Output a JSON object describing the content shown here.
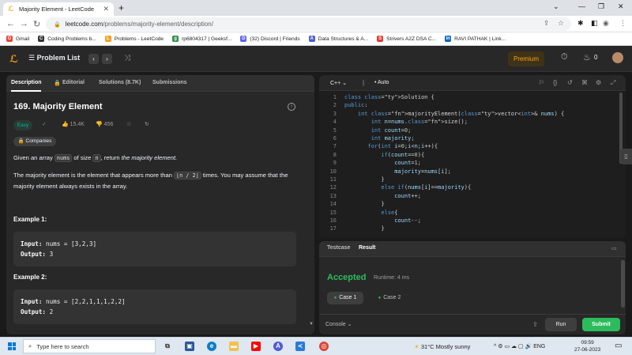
{
  "browser": {
    "tab_title": "Majority Element - LeetCode",
    "url_host": "leetcode.com",
    "url_path": "/problems/majority-element/description/",
    "bookmarks": [
      {
        "label": "Gmail",
        "color": "#ea4335",
        "glyph": "G"
      },
      {
        "label": "Coding Problems b...",
        "color": "#333333",
        "glyph": "C"
      },
      {
        "label": "Problems - LeetCode",
        "color": "#f89f1b",
        "glyph": "L"
      },
      {
        "label": "rp6804317 | Geeksf...",
        "color": "#2f8d46",
        "glyph": "g"
      },
      {
        "label": "(32) Discord | Friends",
        "color": "#5865f2",
        "glyph": "D"
      },
      {
        "label": "Data Structures & A...",
        "color": "#4f5bd5",
        "glyph": "A"
      },
      {
        "label": "Strivers A2Z DSA C...",
        "color": "#e03c31",
        "glyph": "S"
      },
      {
        "label": "RAVI PATHAK | Link...",
        "color": "#0a66c2",
        "glyph": "in"
      }
    ]
  },
  "header": {
    "problem_list": "Problem List",
    "premium": "Premium",
    "streak": "0"
  },
  "left": {
    "tabs": [
      "Description",
      "Editorial",
      "Solutions (8.7K)",
      "Submissions"
    ],
    "title": "169. Majority Element",
    "difficulty": "Easy",
    "likes": "15.4K",
    "dislikes": "456",
    "companies": "Companies",
    "desc1_pre": "Given an array ",
    "desc1_code1": "nums",
    "desc1_mid": " of size ",
    "desc1_code2": "n",
    "desc1_post": ", return ",
    "desc1_em": "the majority element.",
    "desc2_pre": "The majority element is the element that appears more than ",
    "desc2_code": "⌊n / 2⌋",
    "desc2_post": " times. You may assume that the majority element always exists in the array.",
    "examples": [
      {
        "heading": "Example 1:",
        "input_label": "Input:",
        "input": " nums = [3,2,3]",
        "output_label": "Output:",
        "output": " 3"
      },
      {
        "heading": "Example 2:",
        "input_label": "Input:",
        "input": " nums = [2,2,1,1,1,2,2]",
        "output_label": "Output:",
        "output": " 2"
      }
    ]
  },
  "editor": {
    "language": "C++",
    "mode": "Auto",
    "line_numbers": [
      "1",
      "2",
      "3",
      "4",
      "5",
      "6",
      "7",
      "8",
      "9",
      "10",
      "11",
      "12",
      "13",
      "14",
      "15",
      "16",
      "17"
    ]
  },
  "code_lines": [
    "class Solution {",
    "public:",
    "    int majorityElement(vector<int>& nums) {",
    "        int n=nums.size();",
    "        int count=0;",
    "        int majority;",
    "       for(int i=0;i<n;i++){",
    "           if(count==0){",
    "               count=1;",
    "               majority=nums[i];",
    "           }",
    "           else if(nums[i]==majority){",
    "               count++;",
    "           }",
    "           else{",
    "               count--;",
    "           }"
  ],
  "result": {
    "tabs": [
      "Testcase",
      "Result"
    ],
    "status": "Accepted",
    "runtime": "Runtime: 4 ms",
    "case1": "Case 1",
    "case2": "Case 2",
    "console": "Console",
    "run": "Run",
    "submit": "Submit"
  },
  "taskbar": {
    "search_placeholder": "Type here to search",
    "weather": "31°C  Mostly sunny",
    "lang": "ENG",
    "time": "09:59",
    "date": "27-06-2023"
  }
}
